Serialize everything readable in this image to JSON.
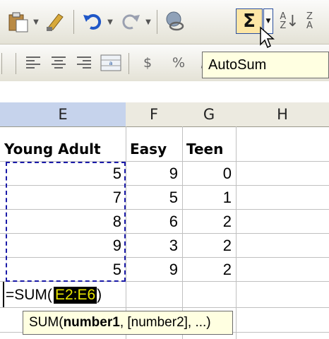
{
  "toolbar": {
    "autosum_symbol": "Σ",
    "autosum_tooltip": "AutoSum",
    "currency_symbol": "$",
    "percent_symbol": "%",
    "comma_symbol": ","
  },
  "sheet": {
    "columns": [
      "E",
      "F",
      "G",
      "H"
    ],
    "selected_column": "E",
    "header_row": [
      "Young Adult",
      "Easy",
      "Teen",
      ""
    ],
    "rows": [
      [
        "5",
        "9",
        "0",
        ""
      ],
      [
        "7",
        "5",
        "1",
        ""
      ],
      [
        "8",
        "6",
        "2",
        ""
      ],
      [
        "9",
        "3",
        "2",
        ""
      ],
      [
        "5",
        "9",
        "2",
        ""
      ]
    ],
    "formula_prefix": "=SUM(",
    "formula_range": "E2:E6",
    "formula_suffix": ")"
  },
  "function_tip": {
    "name": "SUM(",
    "arg1": "number1",
    "rest": ", [number2], ...)"
  },
  "colors": {
    "selection_header": "#c6d3ec",
    "marquee": "#1a1aa8",
    "range_highlight_text": "#e7e400",
    "tooltip_bg": "#ffffe1"
  }
}
